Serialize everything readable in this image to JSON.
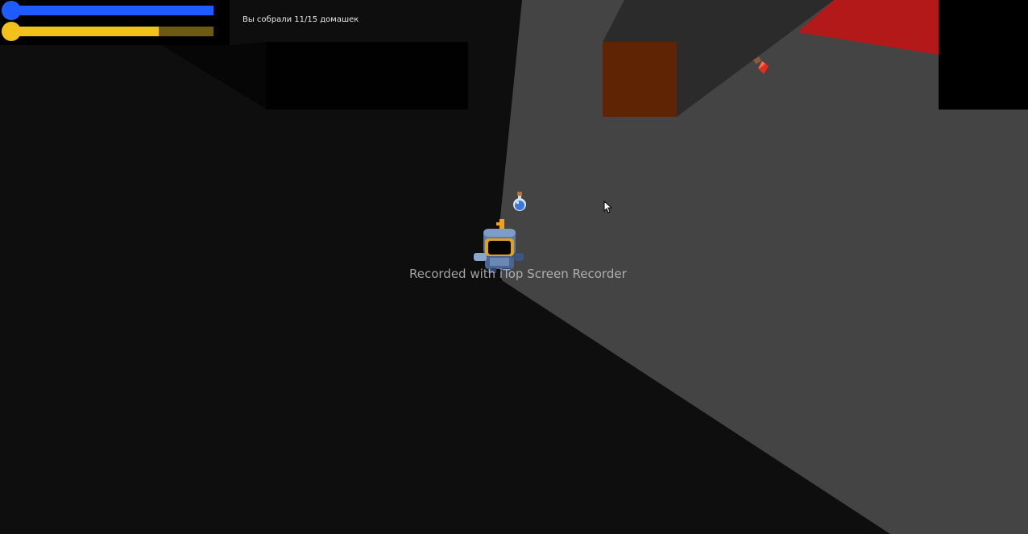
{
  "hud": {
    "health": {
      "value": 1.0,
      "color": "#1f5cff",
      "knob_color": "#1f5cff"
    },
    "stamina": {
      "value": 0.73,
      "color": "#f2c21a",
      "track_color": "#6b5a10",
      "knob_color": "#f2c21a"
    },
    "status_text": "Вы собрали 11/15 домашек"
  },
  "overlay": {
    "watermark": "Recorded with iTop Screen Recorder"
  },
  "scene": {
    "floor_color": "#454445",
    "shadow_color": "#0e0e0e",
    "crate_color": "#5e2404",
    "wall_color": "#b31919"
  },
  "sprites": {
    "player": "knight-icon",
    "potion": "blue-potion-icon",
    "item": "red-gem-icon",
    "cursor": "mouse-cursor-icon"
  }
}
